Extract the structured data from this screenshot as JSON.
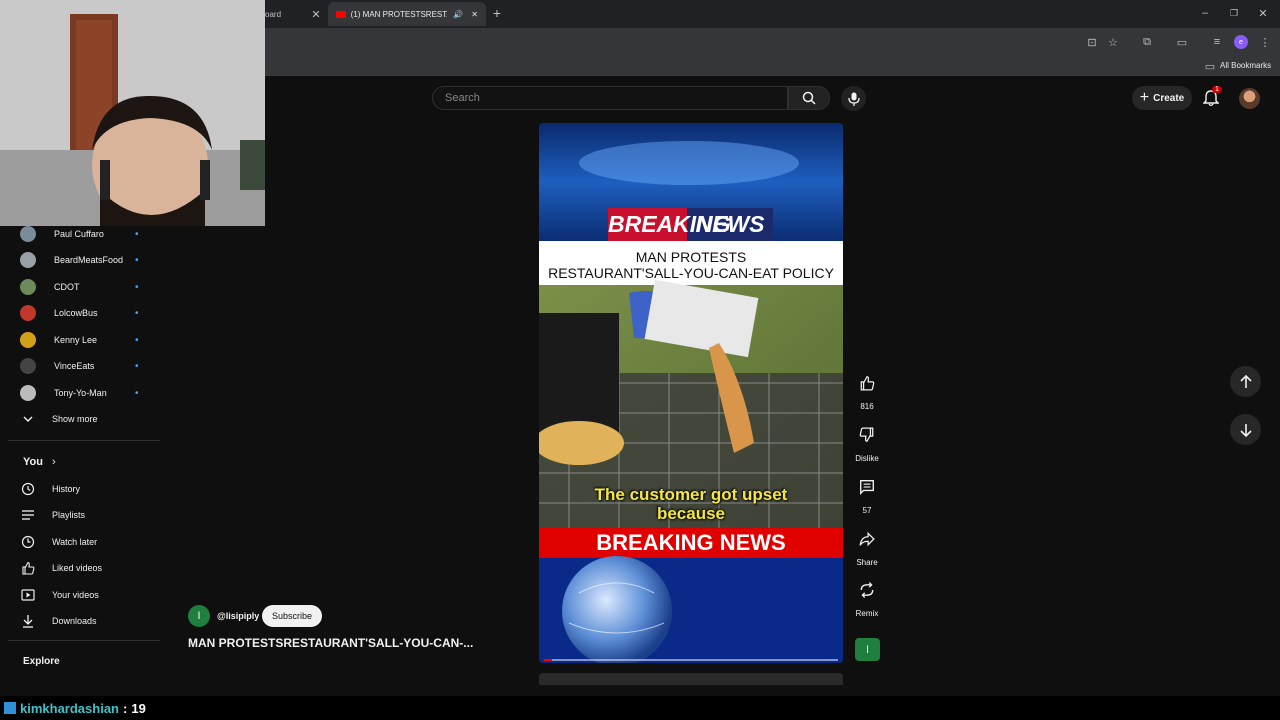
{
  "browser": {
    "tab_left_label": "oard",
    "active_tab_title": "(1) MAN PROTESTSRESTAU",
    "bookmarks_label": "All Bookmarks"
  },
  "header": {
    "search_placeholder": "Search",
    "create_label": "Create",
    "notification_count": "1"
  },
  "sidebar": {
    "subscriptions": [
      {
        "name": "Paul Cuffaro",
        "color": "#7a8c9a"
      },
      {
        "name": "BeardMeatsFood",
        "color": "#9aa0a6"
      },
      {
        "name": "CDOT",
        "color": "#6d8b5a"
      },
      {
        "name": "LolcowBus",
        "color": "#c0392b"
      },
      {
        "name": "Kenny Lee",
        "color": "#d4a017"
      },
      {
        "name": "VinceEats",
        "color": "#444444"
      },
      {
        "name": "Tony-Yo-Man",
        "color": "#bbbbbb"
      }
    ],
    "show_more": "Show more",
    "you_heading": "You",
    "you_items": [
      {
        "label": "History",
        "icon": "history-icon"
      },
      {
        "label": "Playlists",
        "icon": "playlists-icon"
      },
      {
        "label": "Watch later",
        "icon": "watch-later-icon"
      },
      {
        "label": "Liked videos",
        "icon": "liked-icon"
      },
      {
        "label": "Your videos",
        "icon": "your-videos-icon"
      },
      {
        "label": "Downloads",
        "icon": "downloads-icon"
      }
    ],
    "explore_heading": "Explore"
  },
  "short": {
    "banner_top_left": "BREAKING",
    "banner_top_right": "NEWS",
    "headline_line1": "MAN PROTESTS",
    "headline_line2": "RESTAURANT'SALL-YOU-CAN-EAT POLICY",
    "caption": "The customer got upset because",
    "banner_bottom": "BREAKING NEWS",
    "channel_handle": "@lisipiply",
    "channel_initial": "I",
    "subscribe_label": "Subscribe",
    "title": "MAN PROTESTSRESTAURANT'SALL-YOU-CAN-..."
  },
  "actions": {
    "likes": "816",
    "dislike_label": "Dislike",
    "comments": "57",
    "share_label": "Share",
    "remix_label": "Remix",
    "audio_initial": "I"
  },
  "chat": {
    "username": "kimkhardashian",
    "separator": ":",
    "message": "19"
  },
  "colors": {
    "background": "#0f0f0f",
    "accent_red": "#ff0000",
    "link_blue": "#3ea6ff"
  }
}
